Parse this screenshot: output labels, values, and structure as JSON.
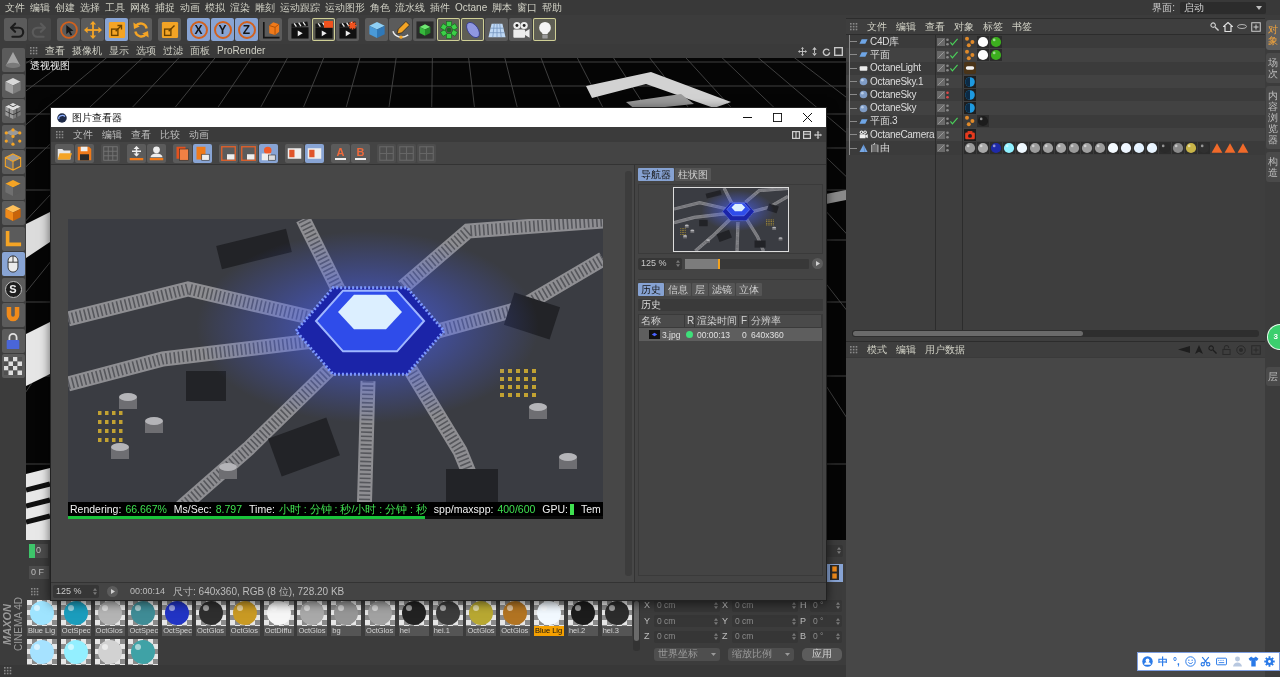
{
  "menu_bar": {
    "items": [
      "文件",
      "编辑",
      "创建",
      "选择",
      "工具",
      "网格",
      "捕捉",
      "动画",
      "模拟",
      "渲染",
      "雕刻",
      "运动跟踪",
      "运动图形",
      "角色",
      "流水线",
      "插件",
      "Octane",
      "脚本",
      "窗口",
      "帮助"
    ],
    "layout_label": "界面:",
    "layout_value": "启动"
  },
  "toolbar": {
    "groups": [
      {
        "items": [
          {
            "kind": "undo",
            "active": false,
            "highlighted": false,
            "disabled": false
          },
          {
            "kind": "redo",
            "active": false,
            "highlighted": false,
            "disabled": true
          }
        ]
      },
      {
        "items": [
          {
            "kind": "select",
            "active": false,
            "highlighted": false,
            "disabled": false
          },
          {
            "kind": "move",
            "active": false,
            "highlighted": false,
            "disabled": false
          },
          {
            "kind": "scale",
            "active": true,
            "highlighted": false,
            "disabled": false
          },
          {
            "kind": "rotate",
            "active": false,
            "highlighted": false,
            "disabled": false
          }
        ]
      },
      {
        "items": [
          {
            "kind": "recent",
            "active": false,
            "highlighted": false,
            "disabled": false
          }
        ]
      },
      {
        "items": [
          {
            "kind": "axis",
            "label": "X",
            "active": true,
            "highlighted": false,
            "disabled": false
          },
          {
            "kind": "axis",
            "label": "Y",
            "active": true,
            "highlighted": false,
            "disabled": false
          },
          {
            "kind": "axis",
            "label": "Z",
            "active": true,
            "highlighted": false,
            "disabled": false
          },
          {
            "kind": "coordinates",
            "active": false,
            "highlighted": false,
            "disabled": false
          }
        ]
      },
      {
        "items": [
          {
            "kind": "render-view",
            "active": false,
            "highlighted": false,
            "disabled": false
          },
          {
            "kind": "render-picture",
            "active": false,
            "highlighted": true,
            "disabled": false
          },
          {
            "kind": "render-settings",
            "active": false,
            "highlighted": false,
            "disabled": false
          }
        ]
      },
      {
        "items": [
          {
            "kind": "cube",
            "active": false,
            "highlighted": false,
            "disabled": false
          },
          {
            "kind": "spline",
            "active": false,
            "highlighted": false,
            "disabled": false
          },
          {
            "kind": "subdivision",
            "active": false,
            "highlighted": false,
            "disabled": false
          },
          {
            "kind": "cloner",
            "active": false,
            "highlighted": true,
            "disabled": false
          },
          {
            "kind": "deformer",
            "active": false,
            "highlighted": true,
            "disabled": false
          },
          {
            "kind": "floor",
            "active": false,
            "highlighted": false,
            "disabled": false
          },
          {
            "kind": "camera",
            "active": false,
            "highlighted": false,
            "disabled": false
          },
          {
            "kind": "light",
            "active": false,
            "highlighted": true,
            "disabled": false
          }
        ]
      }
    ]
  },
  "left_toolbar": [
    {
      "kind": "make-editable",
      "active": false
    },
    {
      "kind": "model",
      "active": false
    },
    {
      "kind": "texture",
      "active": false
    },
    {
      "kind": "points",
      "active": false
    },
    {
      "kind": "edges",
      "active": false
    },
    {
      "kind": "polygons",
      "active": false
    },
    {
      "kind": "uv",
      "active": false
    },
    {
      "kind": "axis-mode",
      "active": false
    },
    {
      "kind": "tweak",
      "active": true
    },
    {
      "kind": "solo",
      "label": "S",
      "active": false
    },
    {
      "kind": "snap",
      "active": false
    },
    {
      "kind": "lock",
      "active": false
    },
    {
      "kind": "workplane",
      "active": false
    }
  ],
  "viewport": {
    "menu": [
      "查看",
      "摄像机",
      "显示",
      "选项",
      "过滤",
      "面板",
      "ProRender"
    ],
    "label": "透视视图"
  },
  "timeline": {
    "marker": "0",
    "frame": "0 F"
  },
  "logo": {
    "brand": "MAXON",
    "product": "CINEMA 4D"
  },
  "materials": {
    "items": [
      {
        "label": "Blue Lig",
        "color": "#9fe4ff",
        "selected": false
      },
      {
        "label": "OctSpec",
        "color": "#1b9dbd",
        "selected": false
      },
      {
        "label": "OctGlos",
        "color": "#b4b4b4",
        "selected": false
      },
      {
        "label": "OctSpec",
        "color": "#3f8c96",
        "selected": false
      },
      {
        "label": "OctSpec",
        "color": "#2234c4",
        "selected": false
      },
      {
        "label": "OctGlos",
        "color": "#2e2e2e",
        "selected": false
      },
      {
        "label": "OctGlos",
        "color": "#c99a24",
        "selected": false
      },
      {
        "label": "OctDiffu",
        "color": "#f6f6f6",
        "selected": false
      },
      {
        "label": "OctGlos",
        "color": "#a9a9a9",
        "selected": false
      },
      {
        "label": "bg",
        "color": "#969696",
        "selected": false
      },
      {
        "label": "OctGlos",
        "color": "#a2a2a2",
        "selected": false
      },
      {
        "label": "hei",
        "color": "#222222",
        "selected": false
      },
      {
        "label": "hei.1",
        "color": "#3c3c3c",
        "selected": false
      },
      {
        "label": "OctGlos",
        "color": "#b8a832",
        "selected": false
      },
      {
        "label": "OctGlos",
        "color": "#b27422",
        "selected": false
      },
      {
        "label": "Blue Lig",
        "color": "#f2f9ff",
        "selected": true
      },
      {
        "label": "hei.2",
        "color": "#1c1c1c",
        "selected": false
      },
      {
        "label": "hei.3",
        "color": "#2c2c2c",
        "selected": false
      },
      {
        "color": "#a6e2ff",
        "selected": false
      },
      {
        "color": "#93efff",
        "selected": false
      },
      {
        "color": "#d2d2d2",
        "selected": false
      },
      {
        "color": "#3fa2a6",
        "selected": false
      }
    ]
  },
  "coordinates": {
    "rows": [
      {
        "position_axis": "X",
        "position": "0 cm",
        "size_axis": "X",
        "size": "0 cm",
        "rotation_axis": "H",
        "rotation": "0 °"
      },
      {
        "position_axis": "Y",
        "position": "0 cm",
        "size_axis": "Y",
        "size": "0 cm",
        "rotation_axis": "P",
        "rotation": "0 °"
      },
      {
        "position_axis": "Z",
        "position": "0 cm",
        "size_axis": "Z",
        "size": "0 cm",
        "rotation_axis": "B",
        "rotation": "0 °"
      }
    ],
    "mode": "世界坐标",
    "scale_mode": "缩放比例",
    "apply": "应用"
  },
  "object_manager": {
    "menu": [
      "文件",
      "编辑",
      "查看",
      "对象",
      "标签",
      "书签"
    ],
    "rows": [
      {
        "name": "C4D库",
        "kind": "plane",
        "enabled": true,
        "hidden": false,
        "tags": [
          {
            "kind": "phong"
          },
          {
            "kind": "material",
            "color": "#ffffff"
          },
          {
            "kind": "material",
            "color": "#3cae1e"
          }
        ]
      },
      {
        "name": "平面",
        "kind": "plane",
        "enabled": true,
        "hidden": false,
        "tags": [
          {
            "kind": "phong"
          },
          {
            "kind": "material",
            "color": "#ffffff"
          },
          {
            "kind": "material",
            "color": "#3cae1e"
          }
        ]
      },
      {
        "name": "OctaneLight",
        "kind": "light",
        "enabled": true,
        "hidden": false,
        "tags": [
          {
            "kind": "octane-light"
          }
        ]
      },
      {
        "name": "OctaneSky.1",
        "kind": "sky",
        "enabled": false,
        "hidden": false,
        "tags": [
          {
            "kind": "octane-sky"
          }
        ]
      },
      {
        "name": "OctaneSky",
        "kind": "sky",
        "enabled": false,
        "hidden": true,
        "tags": [
          {
            "kind": "octane-sky"
          }
        ]
      },
      {
        "name": "OctaneSky",
        "kind": "sky",
        "enabled": false,
        "hidden": false,
        "tags": [
          {
            "kind": "octane-sky"
          }
        ]
      },
      {
        "name": "平面.3",
        "kind": "plane",
        "enabled": true,
        "hidden": false,
        "tags": [
          {
            "kind": "phong"
          },
          {
            "kind": "material",
            "color": "#1c1c1c"
          }
        ]
      },
      {
        "name": "OctaneCamera",
        "kind": "camera",
        "enabled": false,
        "hidden": false,
        "tags": [
          {
            "kind": "octane-camera"
          }
        ]
      },
      {
        "name": "自由",
        "kind": "pyramid",
        "enabled": false,
        "hidden": false,
        "tags": [
          {
            "kind": "material",
            "color": "#9a9a9a"
          },
          {
            "kind": "material",
            "color": "#a8a8a8"
          },
          {
            "kind": "material",
            "color": "#1f2aa8"
          },
          {
            "kind": "material",
            "color": "#8ff0ff"
          },
          {
            "kind": "material",
            "color": "#eef8ff"
          },
          {
            "kind": "material",
            "color": "#9c9c9c"
          },
          {
            "kind": "material",
            "color": "#a0a0a0"
          },
          {
            "kind": "material",
            "color": "#a4a4a4"
          },
          {
            "kind": "material",
            "color": "#9a9a9a"
          },
          {
            "kind": "material",
            "color": "#a0a0a0"
          },
          {
            "kind": "material",
            "color": "#9c9c9c"
          },
          {
            "kind": "material",
            "color": "#f4faff"
          },
          {
            "kind": "material",
            "color": "#eef6ff"
          },
          {
            "kind": "material",
            "color": "#e4f2ff"
          },
          {
            "kind": "material",
            "color": "#e8f4ff"
          },
          {
            "kind": "material",
            "color": "#2a2a2a"
          },
          {
            "kind": "material",
            "color": "#8a8a8a"
          },
          {
            "kind": "material",
            "color": "#c8b448"
          },
          {
            "kind": "material",
            "color": "#303030"
          },
          {
            "kind": "triangle"
          },
          {
            "kind": "triangle"
          },
          {
            "kind": "triangle"
          }
        ]
      }
    ],
    "tabs": [
      {
        "label": "对象",
        "selected": true
      },
      {
        "label": "场次",
        "selected": false
      },
      {
        "label": "内容浏览器",
        "selected": false
      },
      {
        "label": "构造",
        "selected": false
      }
    ]
  },
  "attribute_manager": {
    "menu": [
      "模式",
      "编辑",
      "用户数据"
    ],
    "tabs": [
      {
        "label": "层",
        "selected": false
      }
    ]
  },
  "badge": "3",
  "image_viewer": {
    "title": "图片查看器",
    "menu": [
      "文件",
      "编辑",
      "查看",
      "比较",
      "动画"
    ],
    "toolbar": {
      "groups": [
        {
          "items": [
            {
              "kind": "open",
              "active": false,
              "disabled": false
            },
            {
              "kind": "save",
              "active": false,
              "disabled": false
            }
          ]
        },
        {
          "items": [
            {
              "kind": "grid",
              "active": false,
              "disabled": true
            }
          ]
        },
        {
          "items": [
            {
              "kind": "move-down",
              "active": false,
              "disabled": false
            },
            {
              "kind": "person-down",
              "active": false,
              "disabled": false
            }
          ]
        },
        {
          "items": [
            {
              "kind": "book",
              "active": false,
              "disabled": false
            },
            {
              "kind": "document",
              "active": true,
              "disabled": false
            }
          ]
        },
        {
          "items": [
            {
              "kind": "frame",
              "active": false,
              "disabled": false
            },
            {
              "kind": "frame",
              "active": false,
              "disabled": false
            },
            {
              "kind": "frame-person",
              "active": true,
              "disabled": false
            }
          ]
        },
        {
          "items": [
            {
              "kind": "compare",
              "active": false,
              "disabled": false
            },
            {
              "kind": "compare",
              "active": true,
              "disabled": false
            }
          ]
        },
        {
          "items": [
            {
              "kind": "channel",
              "label": "A",
              "active": false,
              "disabled": false
            },
            {
              "kind": "channel",
              "label": "B",
              "active": false,
              "disabled": false
            }
          ]
        },
        {
          "items": [
            {
              "kind": "panel",
              "active": false,
              "disabled": true
            },
            {
              "kind": "panel",
              "active": false,
              "disabled": true
            },
            {
              "kind": "panel",
              "active": false,
              "disabled": true
            }
          ]
        }
      ]
    },
    "overlay": {
      "items": [
        {
          "kind": "stat",
          "label": "Rendering:",
          "value": "66.667%"
        },
        {
          "kind": "stat",
          "label": "Ms/Sec:",
          "value": "8.797"
        },
        {
          "kind": "stat",
          "label": "Time:",
          "value": "小时 : 分钟 : 秒/小时 : 分钟 : 秒"
        },
        {
          "kind": "stat",
          "label": "spp/maxspp:",
          "value": "400/600"
        },
        {
          "kind": "meter",
          "label": "GPU:"
        },
        {
          "kind": "label",
          "label": "Tem"
        }
      ],
      "level": 0.667
    },
    "navigator": {
      "tabs": [
        {
          "label": "导航器",
          "selected": true
        },
        {
          "label": "柱状图",
          "selected": false
        }
      ],
      "zoom": "125 %",
      "level": 0.28
    },
    "history": {
      "tabs": [
        {
          "label": "历史",
          "selected": true
        },
        {
          "label": "信息",
          "selected": false
        },
        {
          "label": "层",
          "selected": false
        },
        {
          "label": "滤镜",
          "selected": false
        },
        {
          "label": "立体",
          "selected": false
        }
      ],
      "title": "历史",
      "columns": [
        "名称",
        "R",
        "渲染时间",
        "F",
        "分辨率"
      ],
      "rows": [
        {
          "name": "3.jpg",
          "color": "#3ee07a",
          "time": "00:00:13",
          "frame": "0",
          "resolution": "640x360",
          "selected": true
        }
      ]
    },
    "status": {
      "zoom": "125 %",
      "time": "00:00:14",
      "info": "尺寸: 640x360, RGB (8 位), 728.20 KB"
    }
  },
  "ime_bar": {
    "items": [
      {
        "kind": "avatar"
      },
      {
        "kind": "text",
        "label": "中"
      },
      {
        "kind": "text",
        "label": "°,"
      },
      {
        "kind": "smiley"
      },
      {
        "kind": "scissors"
      },
      {
        "kind": "keyboard"
      },
      {
        "kind": "person"
      },
      {
        "kind": "shirt"
      },
      {
        "kind": "gear"
      }
    ]
  }
}
